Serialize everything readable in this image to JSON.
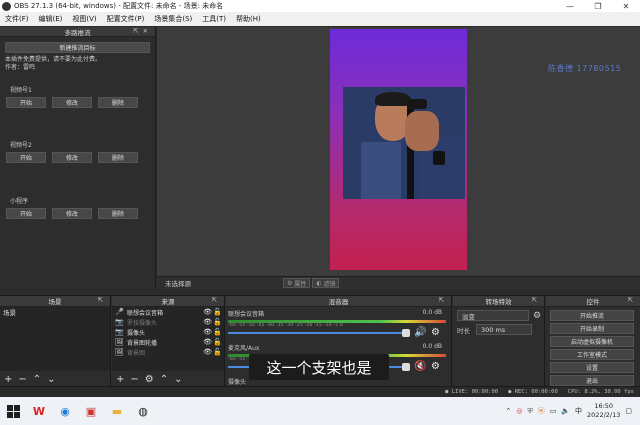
{
  "window": {
    "title": "OBS 27.1.3 (64-bit, windows) - 配置文件: 未命名 - 场景: 未命名",
    "min": "—",
    "max": "❐",
    "close": "✕"
  },
  "menu": [
    "文件(F)",
    "编辑(E)",
    "视图(V)",
    "配置文件(P)",
    "场景集合(S)",
    "工具(T)",
    "帮助(H)"
  ],
  "multistream": {
    "title": "多路推流",
    "new_target": "新建推流目标",
    "note1": "本插件免费提供，请不要为此付费。",
    "note2": "作者：雷鸣",
    "sections": [
      {
        "label": "视频号1",
        "buttons": [
          "开始",
          "修改",
          "删除"
        ]
      },
      {
        "label": "视频号2",
        "buttons": [
          "开始",
          "修改",
          "删除"
        ]
      },
      {
        "label": "小程序",
        "buttons": [
          "开始",
          "修改",
          "删除"
        ]
      }
    ]
  },
  "preview": {
    "watermark": "陈香德 17780515",
    "no_source": "未选择源",
    "properties": "属性",
    "filters": "滤镜"
  },
  "scenes": {
    "title": "场景",
    "items": [
      "场景"
    ]
  },
  "sources": {
    "title": "来源",
    "items": [
      {
        "label": "联想会议音箱",
        "icon": "🎤",
        "dim": false
      },
      {
        "label": "罗技摄像头",
        "icon": "📷",
        "dim": true
      },
      {
        "label": "摄像头",
        "icon": "📷",
        "dim": false
      },
      {
        "label": "背景图轮播",
        "icon": "🖼",
        "dim": false
      },
      {
        "label": "背景图",
        "icon": "🖼",
        "dim": true
      }
    ]
  },
  "mixer": {
    "title": "混音器",
    "channels": [
      {
        "name": "联想会议音箱",
        "db": "0.0 dB",
        "muted": false
      },
      {
        "name": "麦克风/Aux",
        "db": "0.0 dB",
        "muted": true
      },
      {
        "name": "摄像头",
        "db": "0.0 dB",
        "muted": false
      }
    ],
    "ticks": "-60 -55 -50 -45 -40 -35 -30 -25 -20 -15 -10 -5 0"
  },
  "transitions": {
    "title": "转场特效",
    "type": "淡变",
    "duration_label": "时长",
    "duration": "300 ms"
  },
  "controls": {
    "title": "控件",
    "buttons": [
      "开始推流",
      "开始录制",
      "启动虚拟摄像机",
      "工作室模式",
      "设置",
      "退出"
    ]
  },
  "status": {
    "live": "LIVE: 00:00:00",
    "rec": "REC: 00:00:00",
    "cpu": "CPU: 8.2%, 30.00 fps"
  },
  "taskbar": {
    "time": "16:50",
    "date": "2022/2/13"
  },
  "subtitle": "这一个支架也是"
}
